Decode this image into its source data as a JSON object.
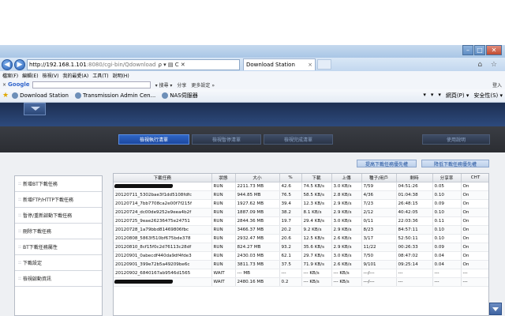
{
  "browser": {
    "address_host": "http://192.168.1.101",
    "address_rest": ":8080/cgi-bin/Qdownload",
    "address_controls": "ρ ▾ ▤ C ✕",
    "tab_title": "Download Station",
    "tab_close": "×",
    "nav_right_icons": "⌂ ☆",
    "window_buttons": [
      "–",
      "□",
      "✕"
    ],
    "menu": [
      "檔案(F)",
      "編輯(E)",
      "檢視(V)",
      "我的最愛(A)",
      "工具(T)",
      "說明(H)"
    ],
    "google": {
      "close": "×",
      "logo": "Google",
      "items": [
        "▾ 搜尋 ▾",
        "分享",
        "更多設定 »"
      ],
      "login": "登入"
    },
    "favorites": [
      "Download Station",
      "Transmission Admin Cen...",
      "NAS伺服器"
    ],
    "fav_right": [
      "▾",
      "▾",
      "▾",
      "網頁(P) ▾",
      "安全性(S) ▾"
    ]
  },
  "ds": {
    "tabs": [
      "檢視執行清單",
      "檢視暫停清單",
      "檢視完成清單",
      "使用說明"
    ],
    "actions": [
      "提高下載任務優先權",
      "降低下載任務優先權"
    ],
    "sidebar": [
      "新增BT下載任務",
      "新增FTP/HTTP下載任務",
      "暫停/重新啟動下載任務",
      "刪除下載任務",
      "BT下載任務屬性",
      "下載設定",
      "檢視啟動資訊"
    ],
    "sidebar_bullet": "::",
    "columns": [
      "下載任務",
      "狀態",
      "大小",
      "%",
      "下載",
      "上傳",
      "種子/用戶",
      "剩時",
      "分享率",
      "CHT"
    ],
    "rows": [
      {
        "name": "",
        "redacted": true,
        "status": "RUN",
        "size": "2211.73 MB",
        "pct": "42.6",
        "down": "74.5 KB/s",
        "up": "3.0 KB/s",
        "peers": "7/59",
        "eta": "04:51:26",
        "ratio": "0.05",
        "cht": "On"
      },
      {
        "name": "20120711_5302bae3f1dd5108fdfc",
        "status": "RUN",
        "size": "944.85 MB",
        "pct": "76.5",
        "down": "58.5 KB/s",
        "up": "2.8 KB/s",
        "peers": "4/36",
        "eta": "01:04:38",
        "ratio": "0.10",
        "cht": "On"
      },
      {
        "name": "20120714_7bb7708ca2e00f7f215f",
        "status": "RUN",
        "size": "1927.62 MB",
        "pct": "39.4",
        "down": "12.3 KB/s",
        "up": "2.9 KB/s",
        "peers": "7/23",
        "eta": "26:48:15",
        "ratio": "0.09",
        "cht": "On"
      },
      {
        "name": "20120724_dc00de9252e9eea4b2f",
        "status": "RUN",
        "size": "1887.09 MB",
        "pct": "38.2",
        "down": "8.1 KB/s",
        "up": "2.9 KB/s",
        "peers": "2/12",
        "eta": "40:42:05",
        "ratio": "0.10",
        "cht": "On"
      },
      {
        "name": "20120725_9eae26236475e24751",
        "status": "RUN",
        "size": "2844.36 MB",
        "pct": "19.7",
        "down": "29.4 KB/s",
        "up": "3.0 KB/s",
        "peers": "0/11",
        "eta": "22:03:36",
        "ratio": "0.11",
        "cht": "On"
      },
      {
        "name": "20120728_1a79bbd81469806fbc",
        "status": "RUN",
        "size": "3466.37 MB",
        "pct": "20.2",
        "down": "9.2 KB/s",
        "up": "2.9 KB/s",
        "peers": "8/23",
        "eta": "84:57:11",
        "ratio": "0.10",
        "cht": "On"
      },
      {
        "name": "20120808_5863f510bf675bde378",
        "status": "RUN",
        "size": "2932.47 MB",
        "pct": "20.6",
        "down": "12.5 KB/s",
        "up": "2.6 KB/s",
        "peers": "3/17",
        "eta": "52:50:11",
        "ratio": "0.10",
        "cht": "On"
      },
      {
        "name": "20120810_8cf15f0c2d76113c28df",
        "status": "RUN",
        "size": "824.27 MB",
        "pct": "93.2",
        "down": "35.6 KB/s",
        "up": "2.9 KB/s",
        "peers": "11/22",
        "eta": "00:26:33",
        "ratio": "0.09",
        "cht": "On"
      },
      {
        "name": "20120901_0abecdf440da9df4fde3",
        "status": "RUN",
        "size": "2430.03 MB",
        "pct": "62.1",
        "down": "29.7 KB/s",
        "up": "3.0 KB/s",
        "peers": "7/50",
        "eta": "08:47:02",
        "ratio": "0.04",
        "cht": "On"
      },
      {
        "name": "20120901_399e72b5a49209be6c",
        "status": "RUN",
        "size": "3811.73 MB",
        "pct": "37.5",
        "down": "71.9 KB/s",
        "up": "2.6 KB/s",
        "peers": "9/101",
        "eta": "09:25:14",
        "ratio": "0.04",
        "cht": "On"
      },
      {
        "name": "20120902_6840167ab9546d1565",
        "status": "WAIT",
        "size": "--- MB",
        "pct": "---",
        "down": "--- KB/s",
        "up": "--- KB/s",
        "peers": "---/---",
        "eta": "---",
        "ratio": "---",
        "cht": "---"
      },
      {
        "name": "",
        "redacted": true,
        "status": "WAIT",
        "size": "2480.16 MB",
        "pct": "0.2",
        "down": "--- KB/s",
        "up": "--- KB/s",
        "peers": "---/---",
        "eta": "---",
        "ratio": "---",
        "cht": "---"
      }
    ]
  }
}
